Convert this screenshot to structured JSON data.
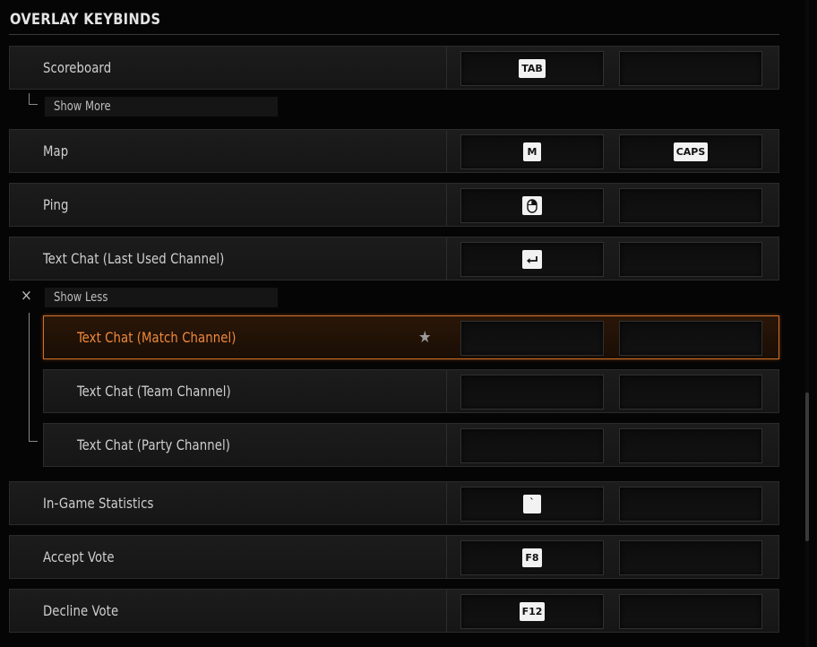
{
  "section": {
    "title": "OVERLAY KEYBINDS"
  },
  "rows": {
    "scoreboard": {
      "label": "Scoreboard",
      "primary": "TAB",
      "secondary": ""
    },
    "map": {
      "label": "Map",
      "primary": "M",
      "secondary": "CAPS"
    },
    "ping": {
      "label": "Ping",
      "primary_icon": "mouse-icon",
      "secondary": ""
    },
    "text_chat_last": {
      "label": "Text Chat (Last Used Channel)",
      "primary_icon": "enter-key-icon",
      "secondary": ""
    },
    "text_chat_match": {
      "label": "Text Chat (Match Channel)",
      "primary": "",
      "secondary": "",
      "favorite_icon": "star-icon"
    },
    "text_chat_team": {
      "label": "Text Chat (Team Channel)",
      "primary": "",
      "secondary": ""
    },
    "text_chat_party": {
      "label": "Text Chat (Party Channel)",
      "primary": "",
      "secondary": ""
    },
    "in_game_statistics": {
      "label": "In-Game Statistics",
      "primary": "`",
      "secondary": ""
    },
    "accept_vote": {
      "label": "Accept Vote",
      "primary": "F8",
      "secondary": ""
    },
    "decline_vote": {
      "label": "Decline Vote",
      "primary": "F12",
      "secondary": ""
    }
  },
  "toggles": {
    "show_more": "Show More",
    "show_less": "Show Less",
    "close_icon": "×"
  },
  "colors": {
    "accent": "#e07a30",
    "background": "#050505"
  }
}
